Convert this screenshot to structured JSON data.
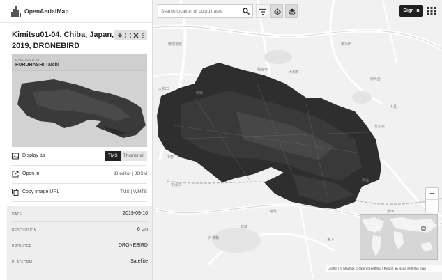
{
  "app": {
    "name": "OpenAerialMap"
  },
  "image": {
    "title": "Kimitsu01-04, Chiba, Japan, 2019, DRONEBIRD",
    "uploaded_by_label": "UPLOADED BY",
    "uploaded_by": "FURUHASHI Taichi"
  },
  "tool_icons": [
    "download-icon",
    "fullscreen-icon",
    "close-icon",
    "more-icon"
  ],
  "actions": {
    "display_as": {
      "label": "Display as",
      "options": [
        "TMS",
        "Thumbnail"
      ],
      "selected": "TMS"
    },
    "open_in": {
      "label": "Open in",
      "links": [
        "iD editor",
        "JOSM"
      ],
      "separator": "|"
    },
    "copy_url": {
      "label": "Copy image URL",
      "links": [
        "TMS",
        "WMTS"
      ],
      "separator": "|"
    }
  },
  "metadata": [
    {
      "key": "DATE",
      "value": "2019-09-10"
    },
    {
      "key": "RESOLUTION",
      "value": "6 cm"
    },
    {
      "key": "PROVIDER",
      "value": "DRONEBIRD"
    },
    {
      "key": "PLATFORM",
      "value": "Satellite"
    }
  ],
  "search": {
    "placeholder": "Search location or coordinates"
  },
  "header": {
    "signin_label": "Sign In"
  },
  "zoom": {
    "in": "+",
    "out": "−"
  },
  "attribution": "Leaflet | © Mapbox © OpenStreetMap | Report an issue with this map",
  "map_labels": [
    "環境省館",
    "館合寺",
    "西郷",
    "大和田",
    "大和町",
    "東坂田",
    "陽光台",
    "北子安",
    "中野",
    "人見",
    "下湯江",
    "君津",
    "常代",
    "外箕輪",
    "箕輪",
    "宮下",
    "太田"
  ],
  "colors": {
    "signin_bg": "#1f1f1f",
    "active_toggle": "#222222",
    "map_bg": "#f1f1f1"
  }
}
